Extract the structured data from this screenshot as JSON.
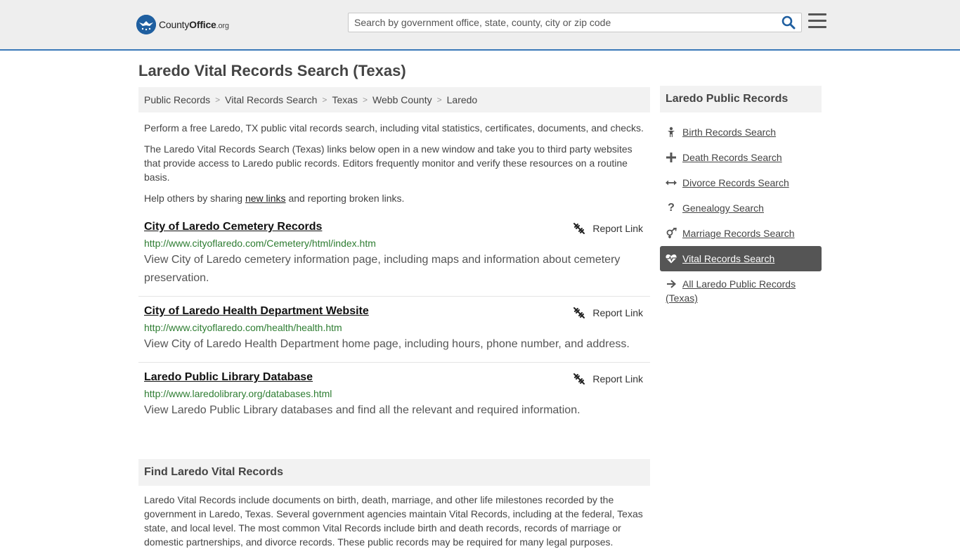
{
  "header": {
    "logo": {
      "brand_light": "County",
      "brand_bold": "Office",
      "brand_suffix": ".org"
    },
    "search": {
      "placeholder": "Search by government office, state, county, city or zip code",
      "value": ""
    },
    "colors": {
      "accent": "#3a79b8",
      "logo_blue": "#1f5fa0"
    }
  },
  "page": {
    "title": "Laredo Vital Records Search (Texas)"
  },
  "breadcrumb": [
    "Public Records",
    "Vital Records Search",
    "Texas",
    "Webb County",
    "Laredo"
  ],
  "intro": {
    "p1": "Perform a free Laredo, TX public vital records search, including vital statistics, certificates, documents, and checks.",
    "p2": "The Laredo Vital Records Search (Texas) links below open in a new window and take you to third party websites that provide access to Laredo public records. Editors frequently monitor and verify these resources on a routine basis.",
    "p3_before": "Help others by sharing ",
    "p3_link": "new links",
    "p3_after": " and reporting broken links."
  },
  "records": [
    {
      "title": "City of Laredo Cemetery Records",
      "url": "http://www.cityoflaredo.com/Cemetery/html/index.htm",
      "description": "View City of Laredo cemetery information page, including maps and information about cemetery preservation.",
      "report_label": "Report Link"
    },
    {
      "title": "City of Laredo Health Department Website",
      "url": "http://www.cityoflaredo.com/health/health.htm",
      "description": "View City of Laredo Health Department home page, including hours, phone number, and address.",
      "report_label": "Report Link"
    },
    {
      "title": "Laredo Public Library Database",
      "url": "http://www.laredolibrary.org/databases.html",
      "description": "View Laredo Public Library databases and find all the relevant and required information.",
      "report_label": "Report Link"
    }
  ],
  "find": {
    "heading": "Find Laredo Vital Records",
    "text": "Laredo Vital Records include documents on birth, death, marriage, and other life milestones recorded by the government in Laredo, Texas. Several government agencies maintain Vital Records, including at the federal, Texas state, and local level. The most common Vital Records include birth and death records, records of marriage or domestic partnerships, and divorce records. These public records may be required for many legal purposes."
  },
  "sidebar": {
    "heading": "Laredo Public Records",
    "items": [
      {
        "label": "Birth Records Search",
        "icon": "child-icon"
      },
      {
        "label": "Death Records Search",
        "icon": "cross-icon"
      },
      {
        "label": "Divorce Records Search",
        "icon": "arrows-horizontal-icon"
      },
      {
        "label": "Genealogy Search",
        "icon": "question-icon"
      },
      {
        "label": "Marriage Records Search",
        "icon": "venus-mars-icon"
      },
      {
        "label": "Vital Records Search",
        "icon": "heartbeat-icon",
        "active": true
      },
      {
        "label": "All Laredo Public Records (Texas)",
        "icon": "arrow-right-icon"
      }
    ],
    "colors": {
      "active_bg": "#555555"
    }
  }
}
